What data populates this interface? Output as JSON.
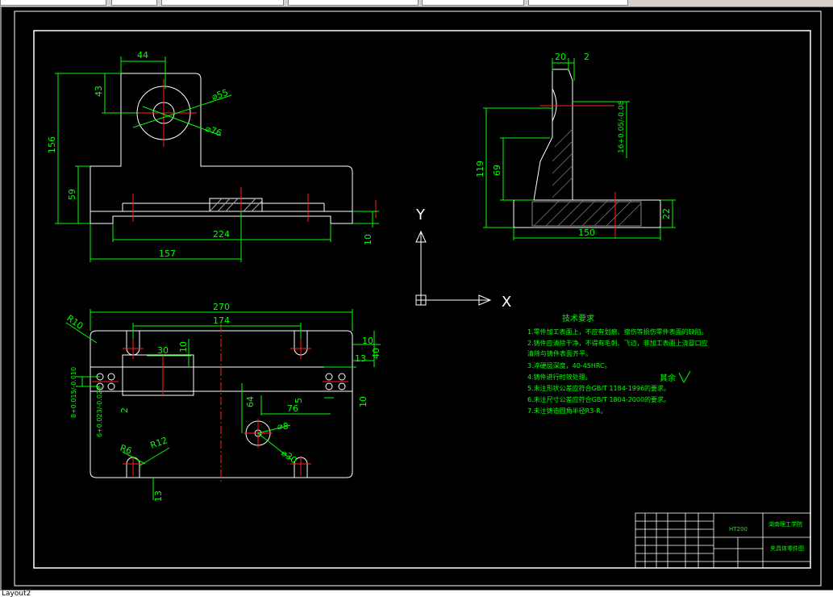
{
  "window": {
    "layout_tab": "Layout2"
  },
  "dimensions": {
    "front": [
      "44",
      "43",
      "156",
      "59",
      "224",
      "157",
      "10",
      "⌀55",
      "⌀76"
    ],
    "side": [
      "20",
      "2",
      "119",
      "69",
      "22",
      "150",
      "16+0.05/-0.08"
    ],
    "top": [
      "270",
      "174",
      "30",
      "10",
      "10",
      "40",
      "13",
      "5",
      "76",
      "64",
      "10",
      "2",
      "⌀8",
      "⌀30",
      "R10",
      "R6",
      "R12",
      "13",
      "8+0.015/-0.010",
      "6+0.023/-0.022"
    ]
  },
  "ucs": {
    "y_label": "Y",
    "x_label": "X"
  },
  "notes": {
    "title": "技术要求",
    "lines": [
      "1.零件加工表面上，不应有划痕、擦伤等损伤零件表面的缺陷。",
      "2.铸件应清除干净，不得有毛刺、飞边，非加工表面上浇冒口应",
      "清除与铸件表面齐平。",
      "3.淬硬层深度，40-45HRC。",
      "4.铸件进行时效处理。",
      "5.未注形状公差应符合GB/T 1184-1996的要求。",
      "6.未注尺寸公差应符合GB/T 1804-2000的要求。",
      "7.未注铸造圆角半径R3-R。"
    ],
    "roughness": "其余"
  },
  "title_block": {
    "school": "湖南理工学院",
    "drawing": "夹具体零件图",
    "code": "HT200"
  }
}
